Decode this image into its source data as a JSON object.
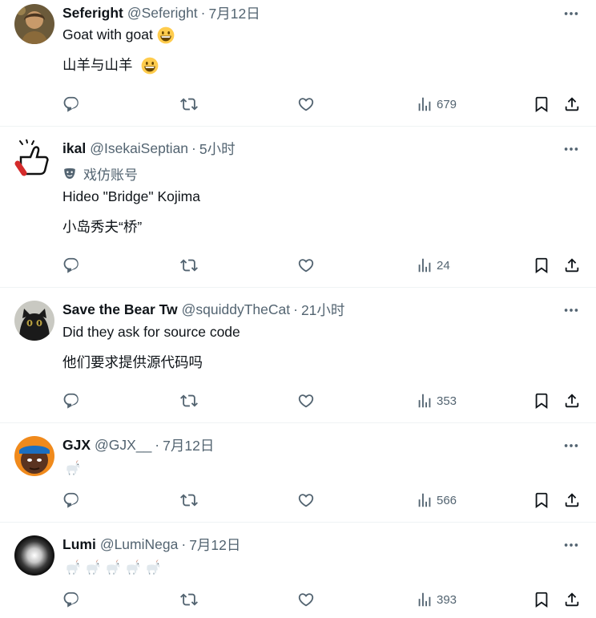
{
  "tweets": [
    {
      "name": "Seferight",
      "handle": "@Seferight",
      "time": "7月12日",
      "text": "Goat with goat",
      "text_emoji": "grinning-face-emoji",
      "translation": "山羊与山羊",
      "translation_emoji": "grinning-face-emoji",
      "views": "679"
    },
    {
      "name": "ikal",
      "handle": "@IsekaiSeptian",
      "time": "5小时",
      "badge": "戏仿账号",
      "text": "Hideo \"Bridge\" Kojima",
      "translation": "小岛秀夫“桥”",
      "views": "24"
    },
    {
      "name": "Save the Bear Tw",
      "handle": "@squiddyTheCat",
      "time": "21小时",
      "text": "Did they ask for source code",
      "translation": "他们要求提供源代码吗",
      "views": "353"
    },
    {
      "name": "GJX",
      "handle": "@GJX__",
      "time": "7月12日",
      "emoji_count": 1,
      "emoji": "goat-emoji",
      "views": "566"
    },
    {
      "name": "Lumi",
      "handle": "@LumiNega",
      "time": "7月12日",
      "emoji_count": 5,
      "emoji": "goat-emoji",
      "views": "393"
    }
  ],
  "separator": "·",
  "colors": {
    "primary_text": "#0f1419",
    "secondary_text": "#536471",
    "divider": "#eff3f4",
    "emoji_yellow": "#ffcc4d"
  }
}
